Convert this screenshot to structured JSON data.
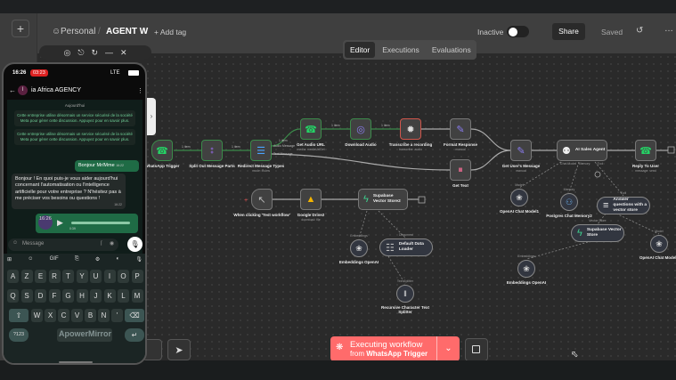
{
  "header": {
    "breadcrumb_project": "Personal",
    "workflow_name": "AGENT W",
    "add_tag": "+ Add tag",
    "status_label": "Inactive",
    "share": "Share",
    "saved": "Saved",
    "more": "…",
    "new_button": "+"
  },
  "tabs": [
    {
      "label": "Editor",
      "active": true
    },
    {
      "label": "Executions"
    },
    {
      "label": "Evaluations"
    }
  ],
  "edge_labels": [
    "1 item",
    "1 item",
    "1 item",
    "1 item",
    "1 item"
  ],
  "nodes": [
    {
      "id": "wa",
      "label": "WhatsApp Trigger",
      "icon": "whatsapp-icon",
      "glyph": "☎"
    },
    {
      "id": "split",
      "label": "Split Out Message Parts",
      "icon": "split-icon",
      "glyph": "⦂"
    },
    {
      "id": "redirect",
      "label": "Redirect Message Types",
      "sub": "mode: Rules",
      "icon": "switch-icon",
      "glyph": "☰",
      "outputs": [
        "Audio Message",
        "Text Message"
      ]
    },
    {
      "id": "audiourl",
      "label": "Get Audio URL",
      "sub": "media: mediaUrlGet",
      "icon": "whatsapp-icon",
      "glyph": "☎"
    },
    {
      "id": "download",
      "label": "Download Audio",
      "icon": "globe-icon",
      "glyph": "◎"
    },
    {
      "id": "transcribe",
      "label": "Transcribe a recording",
      "sub": "transcribe: audio",
      "icon": "openai-icon",
      "glyph": "✹"
    },
    {
      "id": "format",
      "label": "Format Response",
      "sub": "manual",
      "icon": "pencil-icon",
      "glyph": "✎"
    },
    {
      "id": "gettext",
      "label": "Get Text",
      "icon": "pause-icon",
      "glyph": "⏸"
    },
    {
      "id": "usermsg",
      "label": "Get User's Message",
      "sub": "manual",
      "icon": "pencil-icon",
      "glyph": "✎"
    },
    {
      "id": "agent",
      "label": "AI Sales Agent",
      "icon": "robot-icon",
      "glyph": "⚉",
      "ports": [
        "Chat Model",
        "Memory",
        "Tool"
      ]
    },
    {
      "id": "reply",
      "label": "Reply To User",
      "sub": "message: send",
      "icon": "whatsapp-icon",
      "glyph": "☎"
    },
    {
      "id": "manual",
      "label": "When clicking 'Test workflow'",
      "icon": "cursor-icon",
      "glyph": "↖"
    },
    {
      "id": "gdrive",
      "label": "Google Drive2",
      "sub": "download: file",
      "icon": "google-drive-icon",
      "glyph": "▲"
    },
    {
      "id": "supa2",
      "label": "Supabase Vector Store2",
      "icon": "supabase-icon",
      "glyph": "ϟ"
    },
    {
      "id": "oai1",
      "label": "OpenAI Chat Model1",
      "icon": "openai-icon",
      "glyph": "❀",
      "port": "Model"
    },
    {
      "id": "pg",
      "label": "Postgres Chat Memory2",
      "icon": "postgres-icon",
      "glyph": "⚇",
      "port": "Memory"
    },
    {
      "id": "answer",
      "label": "Answer questions with a vector store",
      "icon": "database-icon",
      "glyph": "≡",
      "port": "Tool"
    },
    {
      "id": "supa",
      "label": "Supabase Vector Store",
      "icon": "supabase-icon",
      "glyph": "ϟ",
      "port": "Vector Store"
    },
    {
      "id": "oai3",
      "label": "OpenAI Chat Model3",
      "icon": "openai-icon",
      "glyph": "❀",
      "port": "Model"
    },
    {
      "id": "emb1",
      "label": "Embeddings OpenAI",
      "icon": "openai-icon",
      "glyph": "❀",
      "port": "Embeddings"
    },
    {
      "id": "emb2",
      "label": "Embeddings OpenAI",
      "icon": "openai-icon",
      "glyph": "❀",
      "port": "Embeddings"
    },
    {
      "id": "loader",
      "label": "Default Data Loader",
      "icon": "document-icon",
      "glyph": "☷",
      "port": "Document"
    },
    {
      "id": "splitter",
      "label": "Recursive Character Text Splitter",
      "icon": "splitter-icon",
      "glyph": "‖",
      "port": "Text Splitter"
    }
  ],
  "execution": {
    "title": "Executing workflow",
    "subtitle_prefix": "from",
    "subtitle_node": "WhatsApp Trigger"
  },
  "phone": {
    "time": "16:26",
    "record": "03:23",
    "network": "LTE",
    "contact": "ia Africa AGENCY",
    "contact_initial": "I",
    "date": "Aujourd'hui",
    "system_msgs": [
      "Cette entreprise utilise désormais un service sécurisé de la société Meta pour gérer cette discussion. Appuyez pour en savoir plus.",
      "Cette entreprise utilise désormais un service sécurisé de la société Meta pour gérer cette discussion. Appuyez pour en savoir plus."
    ],
    "out_msg": "Bonjour Mr/Mme",
    "out_time": "16:22",
    "in_msg": "Bonjour ! En quoi puis-je vous aider aujourd'hui concernant l'automatisation ou l'intelligence artificielle pour votre entreprise ? N'hésitez pas à me préciser vos besoins ou questions !",
    "in_time": "16:22",
    "voice_duration": "0:39",
    "voice_time": "16:26",
    "input_placeholder": "Message",
    "keyboard_tools": [
      "⊞",
      "☺",
      "GIF",
      "⎘",
      "⚙",
      "◐",
      "🎙"
    ],
    "rows": [
      [
        "A",
        "Z",
        "E",
        "R",
        "T",
        "Y",
        "U",
        "I",
        "O",
        "P"
      ],
      [
        "Q",
        "S",
        "D",
        "F",
        "G",
        "H",
        "J",
        "K",
        "L",
        "M"
      ],
      [
        "W",
        "X",
        "C",
        "V",
        "B",
        "N",
        "'"
      ]
    ],
    "sym_key": "?123",
    "watermark": "ApowerMirror"
  },
  "colors": {
    "accent": "#ff6b6b",
    "success": "#3b8a4a",
    "canvas": "#2a2a2a",
    "whatsapp": "#25d366"
  }
}
